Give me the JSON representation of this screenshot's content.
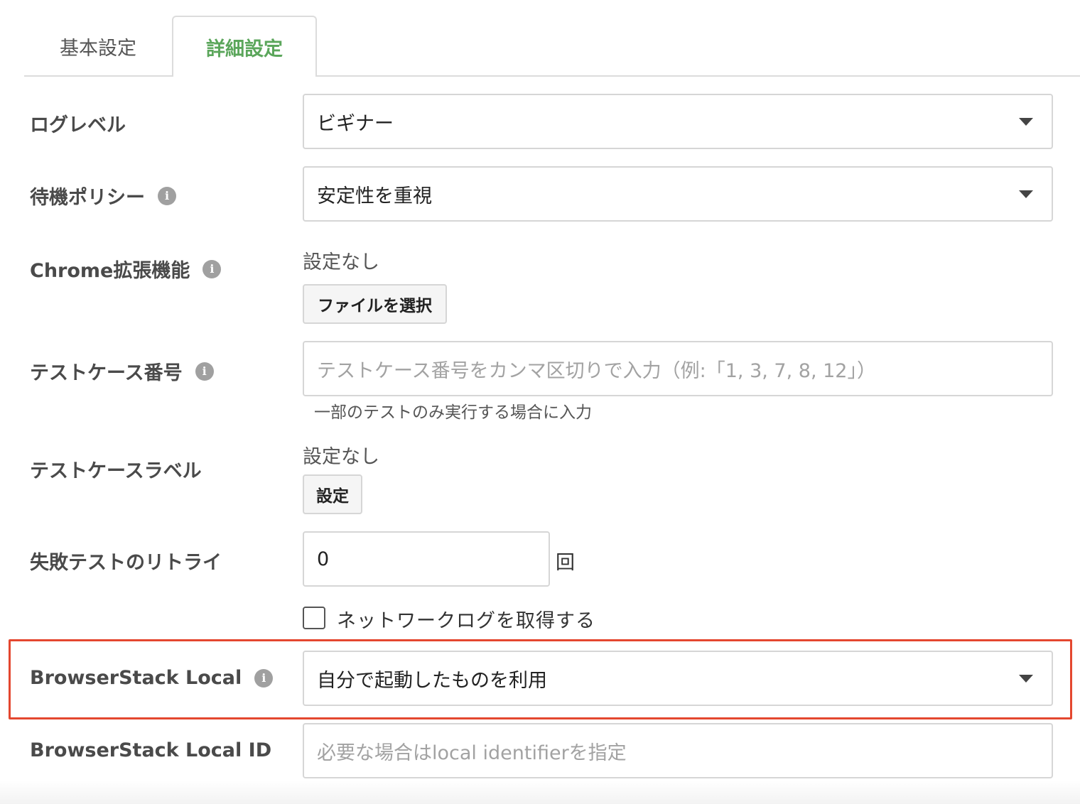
{
  "tabs": {
    "basic": "基本設定",
    "advanced": "詳細設定"
  },
  "settings": {
    "log_level": {
      "label": "ログレベル",
      "value": "ビギナー"
    },
    "wait_policy": {
      "label": "待機ポリシー",
      "value": "安定性を重視"
    },
    "chrome_ext": {
      "label": "Chrome拡張機能",
      "status": "設定なし",
      "button": "ファイルを選択"
    },
    "testcase_no": {
      "label": "テストケース番号",
      "placeholder": "テストケース番号をカンマ区切りで入力（例:「1, 3, 7, 8, 12」）",
      "help": "一部のテストのみ実行する場合に入力"
    },
    "testcase_label": {
      "label": "テストケースラベル",
      "status": "設定なし",
      "button": "設定"
    },
    "retry": {
      "label": "失敗テストのリトライ",
      "value": "0",
      "unit": "回"
    },
    "network_log": {
      "label": "ネットワークログを取得する",
      "checked": false
    },
    "bs_local": {
      "label": "BrowserStack Local",
      "value": "自分で起動したものを利用"
    },
    "bs_local_id": {
      "label": "BrowserStack Local ID",
      "placeholder": "必要な場合はlocal identifierを指定"
    }
  },
  "icons": {
    "info": "i"
  },
  "colors": {
    "active_tab": "#5ba65b",
    "highlight": "#e4472f",
    "info_icon": "#a0a0a0"
  }
}
